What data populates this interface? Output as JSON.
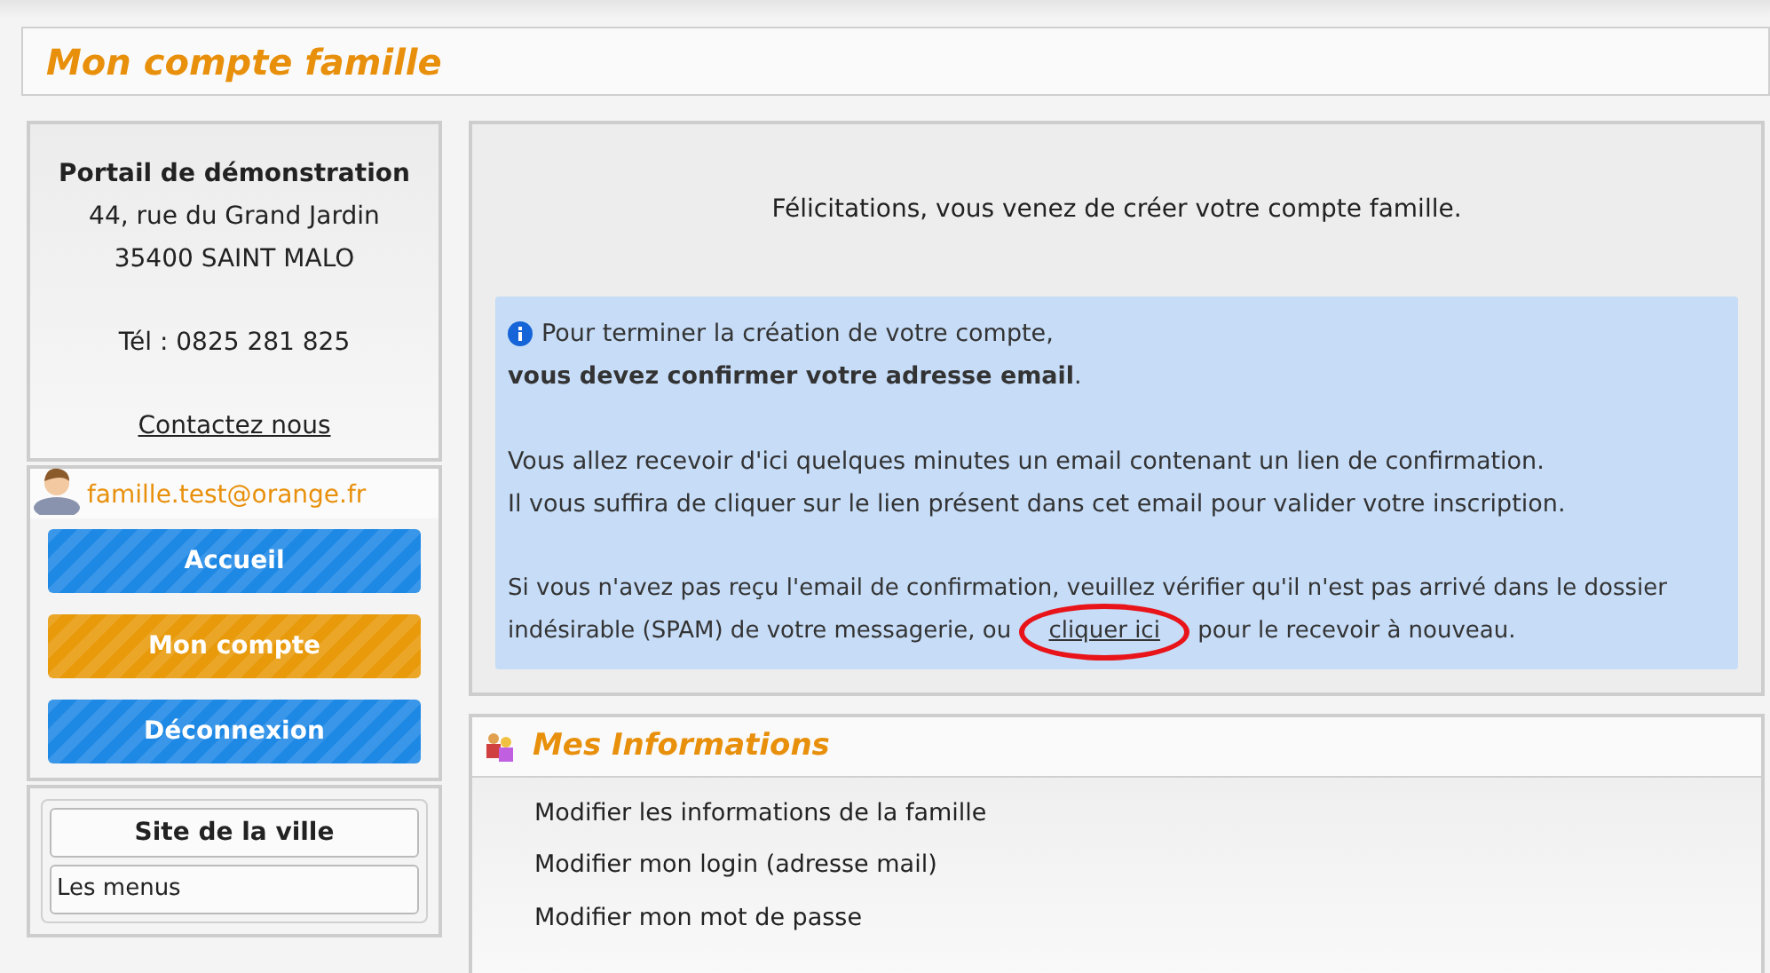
{
  "header": {
    "title": "Mon compte famille"
  },
  "contact_card": {
    "name": "Portail de démonstration",
    "address_lines": [
      "44, rue du Grand Jardin",
      "35400 SAINT MALO"
    ],
    "phone": "Tél : 0825 281 825",
    "link": "Contactez nous"
  },
  "user": {
    "email": "famille.test@orange.fr"
  },
  "nav_buttons": [
    {
      "label": "Accueil",
      "selected": false
    },
    {
      "label": "Mon compte",
      "selected": true
    },
    {
      "label": "Déconnexion",
      "selected": false
    }
  ],
  "city_box": {
    "title": "Site de la ville",
    "items": [
      "Les menus"
    ]
  },
  "message": "Félicitations, vous venez de créer votre compte famille.",
  "info_panel": {
    "lines": [
      "Pour terminer la création de votre compte,",
      "**vous devez confirmer votre adresse email**."
    ],
    "paragraphs": [
      "Vous allez recevoir d'ici quelques minutes un email contenant un lien de confirmation.",
      "Il vous suffira de cliquer sur le lien présent dans cet email pour valider votre inscription."
    ],
    "resend": {
      "before": "Si vous n'avez pas reçu l'email de confirmation, veuillez vérifier qu'il n'est pas arrivé dans le dossier indésirable (SPAM) de votre messagerie, ou",
      "link": "cliquer ici",
      "after": "pour le recevoir à nouveau.",
      "circled": true
    }
  },
  "mes_informations": {
    "title": "Mes Informations",
    "links": [
      "Modifier les informations de la famille",
      "Modifier mon login (adresse mail)",
      "Modifier mon mot de passe"
    ]
  }
}
